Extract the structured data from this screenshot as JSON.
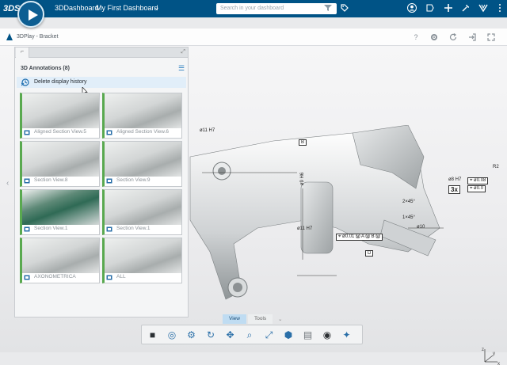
{
  "topbar": {
    "logo": "3DS",
    "brand": "3DDashboard",
    "dashboard": "My First Dashboard",
    "chevron": "⌄",
    "search_placeholder": "Search in your dashboard",
    "colors": {
      "bar": "#005386",
      "compass": "#0d5e92"
    },
    "icons": [
      "filter-icon",
      "tag-icon",
      "user-icon",
      "share-icon",
      "add-icon",
      "tools-icon",
      "compass-icon"
    ]
  },
  "appbar": {
    "title": "3DPlay - Bracket",
    "icons": [
      "help-icon",
      "settings-icon",
      "refresh-icon",
      "exit-icon",
      "maximize-icon"
    ],
    "help": "?"
  },
  "panel": {
    "tab": "⌐",
    "expand": "⤢",
    "title": "3D Annotations (8)",
    "menu": "☰",
    "delete_history": "Delete display history",
    "thumbnails": [
      {
        "label": "Aligned Section View.5",
        "style": "light"
      },
      {
        "label": "Aligned Section View.6",
        "style": "light"
      },
      {
        "label": "Section View.8",
        "style": "light"
      },
      {
        "label": "Section View.9",
        "style": "light"
      },
      {
        "label": "Section View.1",
        "style": "dark"
      },
      {
        "label": "Section View.1",
        "style": "light"
      },
      {
        "label": "AXONOMETRICA",
        "style": "light"
      },
      {
        "label": "ALL",
        "style": "light"
      }
    ],
    "accent": "#59a94f"
  },
  "nav": {
    "left_arrow": "‹"
  },
  "model": {
    "annotations": {
      "top": "ø11 H7",
      "datum_b": "B",
      "vertical_dim": "ø9 H6",
      "bottom_dim": "ø11 H7",
      "fcf_pos": "⌖ ø0.01 Ⓜ A Ⓜ B Ⓜ",
      "datum_d": "D",
      "chamfer1": "2×45°",
      "chamfer2": "1×45°",
      "dia10": "ø10",
      "dia8": "ø8 H7",
      "count": "3x",
      "fcf_right1": "⌖ ø0.08",
      "fcf_right2": "⌖ ø0.0",
      "r2": "R2"
    }
  },
  "viewtabs": {
    "view": "View",
    "tools": "Tools",
    "active": "View"
  },
  "toolbar": {
    "icons": [
      "display-mode-icon",
      "measure-icon",
      "annotation-icon",
      "rotate-icon",
      "pan-icon",
      "zoom-icon",
      "fit-all-icon",
      "view-cube-icon",
      "section-icon",
      "visibility-icon",
      "compass-tool-icon"
    ]
  },
  "axis": {
    "x": "x",
    "y": "y",
    "z": "z"
  }
}
